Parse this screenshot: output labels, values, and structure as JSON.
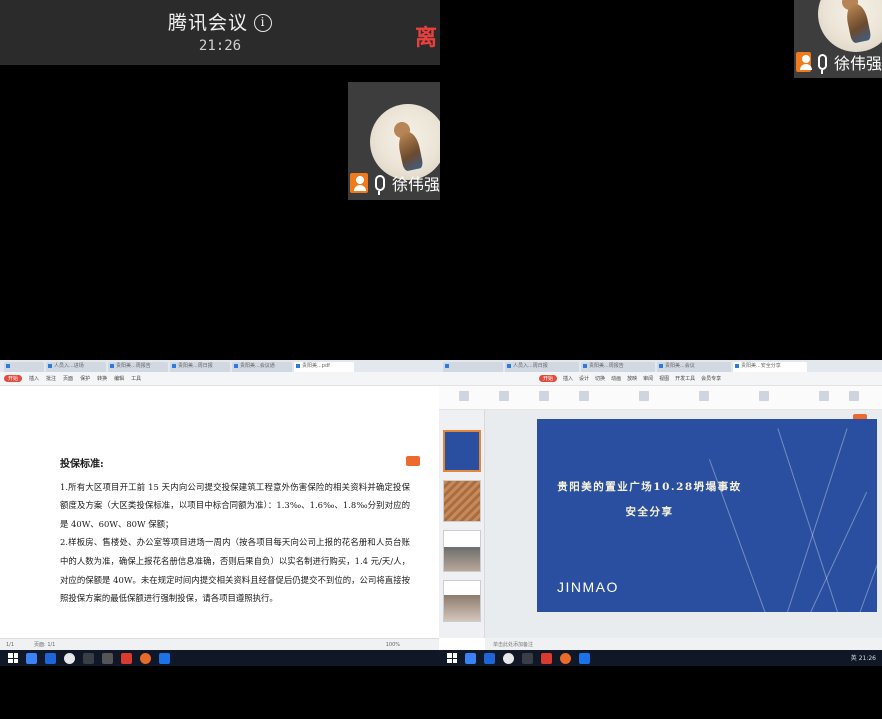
{
  "meeting": {
    "app_title": "腾讯会议",
    "info_glyph": "i",
    "clock": "21:26",
    "leave_label": "离"
  },
  "participants": [
    {
      "name": "徐伟强"
    },
    {
      "name": "徐伟强"
    }
  ],
  "left_screen": {
    "tabs": [
      "",
      "人员入...进场",
      "贵阳美...周报告",
      "贵阳美...周日报",
      "贵阳美...会议通",
      "贵阳美...pdf"
    ],
    "ribbon": [
      "开始",
      "插入",
      "批注",
      "页面",
      "保护",
      "转换",
      "编辑",
      "工具"
    ],
    "doc": {
      "heading": "投保标准:",
      "para1": "1.所有大区项目开工前 15 天内向公司提交投保建筑工程意外伤害保险的相关资料并确定投保额度及方案（大区类投保标准，以项目中标合同额为准）：1.3‰、1.6‰、1.8‰分别对应的是 40W、60W、80W 保额；",
      "para2": "2.样板房、售楼处、办公室等项目进场一周内（按各项目每天向公司上报的花名册和人员台账中的人数为准，确保上报花名册信息准确，否则后果自负）以实名制进行购买，1.4 元/天/人，对应的保额是 40W。未在规定时间内提交相关资料且经督促后仍提交不到位的，公司将直接按照投保方案的最低保额进行强制投保，请各项目遵照执行。"
    },
    "status": [
      "1/1",
      "页面: 1/1",
      "100%"
    ]
  },
  "right_screen": {
    "tabs": [
      "",
      "人员入...周日报",
      "贵阳美...周报告",
      "贵阳美...会议",
      "贵阳美...安全分享"
    ],
    "ribbon": [
      "开始",
      "插入",
      "设计",
      "切换",
      "动画",
      "放映",
      "审阅",
      "视图",
      "开发工具",
      "会员专享"
    ],
    "slide": {
      "title_line1": "贵阳美的置业广场10.28坍塌事故",
      "title_line2": "安全分享",
      "logo": "JINMAO"
    },
    "notes_placeholder": "单击此处添加备注"
  },
  "taskbar": {
    "tray": "英 21:26"
  },
  "colors": {
    "leave_red": "#e8413d",
    "user_badge": "#ef7b1e",
    "slide_blue": "#2a4fa0",
    "wps_red": "#e24b3f"
  }
}
